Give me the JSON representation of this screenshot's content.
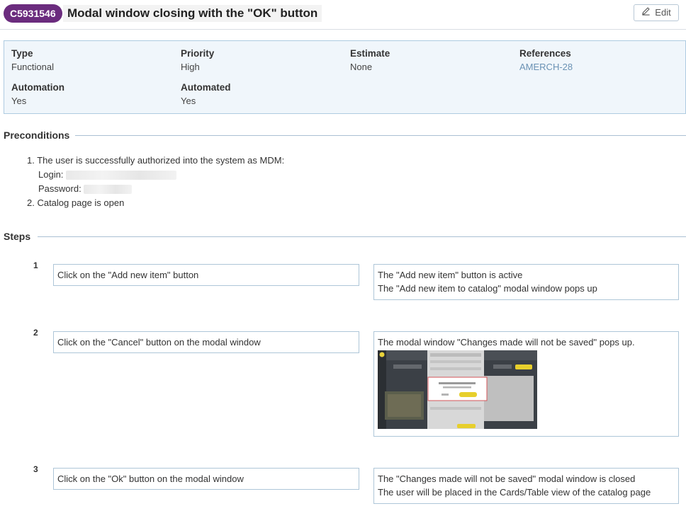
{
  "header": {
    "case_id": "C5931546",
    "title": "Modal window closing with the \"OK\" button",
    "edit_label": "Edit"
  },
  "details": {
    "type_label": "Type",
    "type_value": "Functional",
    "priority_label": "Priority",
    "priority_value": "High",
    "estimate_label": "Estimate",
    "estimate_value": "None",
    "references_label": "References",
    "references_value": "AMERCH-28",
    "automation_label": "Automation",
    "automation_value": "Yes",
    "automated_label": "Automated",
    "automated_value": "Yes"
  },
  "preconditions": {
    "title": "Preconditions",
    "item1": "1. The user is successfully authorized into the system as MDM:",
    "login_label": "Login:",
    "password_label": "Password:",
    "item2": "2. Catalog page is open"
  },
  "steps": {
    "title": "Steps",
    "list": [
      {
        "num": "1",
        "action": "Click on the \"Add new item\" button",
        "expected_line1": "The \"Add new item\" button is active",
        "expected_line2": "The \"Add new item to catalog\" modal window pops up"
      },
      {
        "num": "2",
        "action": "Click on the \"Cancel\" button on the modal window",
        "expected_line1": "The  modal window \"Changes made will not be saved\" pops up."
      },
      {
        "num": "3",
        "action": "Click on the \"Ok\" button on the modal window",
        "expected_line1": "The \"Changes made will not be saved\" modal window is closed",
        "expected_line2": "The user will be placed in the Cards/Table view of the catalog page"
      }
    ]
  },
  "colors": {
    "case_badge": "#6b2c7e",
    "info_box_bg": "#f0f6fb",
    "info_box_border": "#aecbe1",
    "link": "#6a92b4"
  }
}
